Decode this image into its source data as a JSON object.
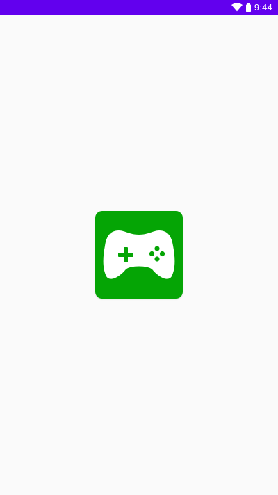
{
  "status_bar": {
    "time": "9:44",
    "wifi_icon": "wifi-icon",
    "battery_icon": "battery-icon",
    "background_color": "#6200ee"
  },
  "splash": {
    "background_color": "#fafafa",
    "app_icon": {
      "icon": "gamepad-icon",
      "tile_color": "#05a505",
      "glyph_color": "#ffffff"
    }
  }
}
